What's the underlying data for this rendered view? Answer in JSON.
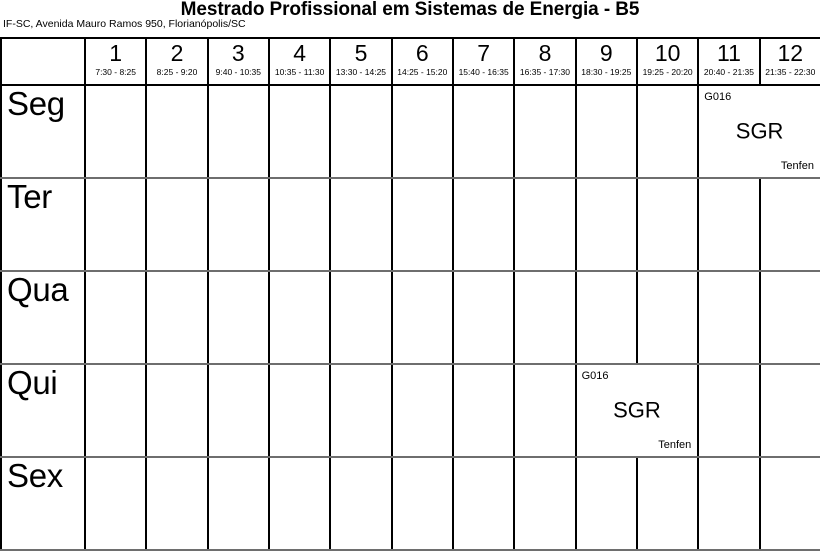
{
  "header": {
    "title": "Mestrado Profissional em Sistemas de Energia - B5",
    "subtitle": "IF-SC, Avenida Mauro Ramos 950, Florianópolis/SC"
  },
  "timetable": {
    "corner_label": "",
    "slots": [
      {
        "num": "1",
        "time": "7:30 - 8:25"
      },
      {
        "num": "2",
        "time": "8:25 - 9:20"
      },
      {
        "num": "3",
        "time": "9:40 - 10:35"
      },
      {
        "num": "4",
        "time": "10:35 - 11:30"
      },
      {
        "num": "5",
        "time": "13:30 - 14:25"
      },
      {
        "num": "6",
        "time": "14:25 - 15:20"
      },
      {
        "num": "7",
        "time": "15:40 - 16:35"
      },
      {
        "num": "8",
        "time": "16:35 - 17:30"
      },
      {
        "num": "9",
        "time": "18:30 - 19:25"
      },
      {
        "num": "10",
        "time": "19:25 - 20:20"
      },
      {
        "num": "11",
        "time": "20:40 - 21:35"
      },
      {
        "num": "12",
        "time": "21:35 - 22:30"
      }
    ],
    "days": [
      {
        "label": "Seg"
      },
      {
        "label": "Ter"
      },
      {
        "label": "Qua"
      },
      {
        "label": "Qui"
      },
      {
        "label": "Sex"
      }
    ],
    "classes": [
      {
        "day": "Seg",
        "start_slot": "11",
        "end_slot": "12",
        "room": "G016",
        "subject": "SGR",
        "teacher": "Tenfen"
      },
      {
        "day": "Qui",
        "start_slot": "9",
        "end_slot": "10",
        "room": "G016",
        "subject": "SGR",
        "teacher": "Tenfen"
      }
    ]
  }
}
